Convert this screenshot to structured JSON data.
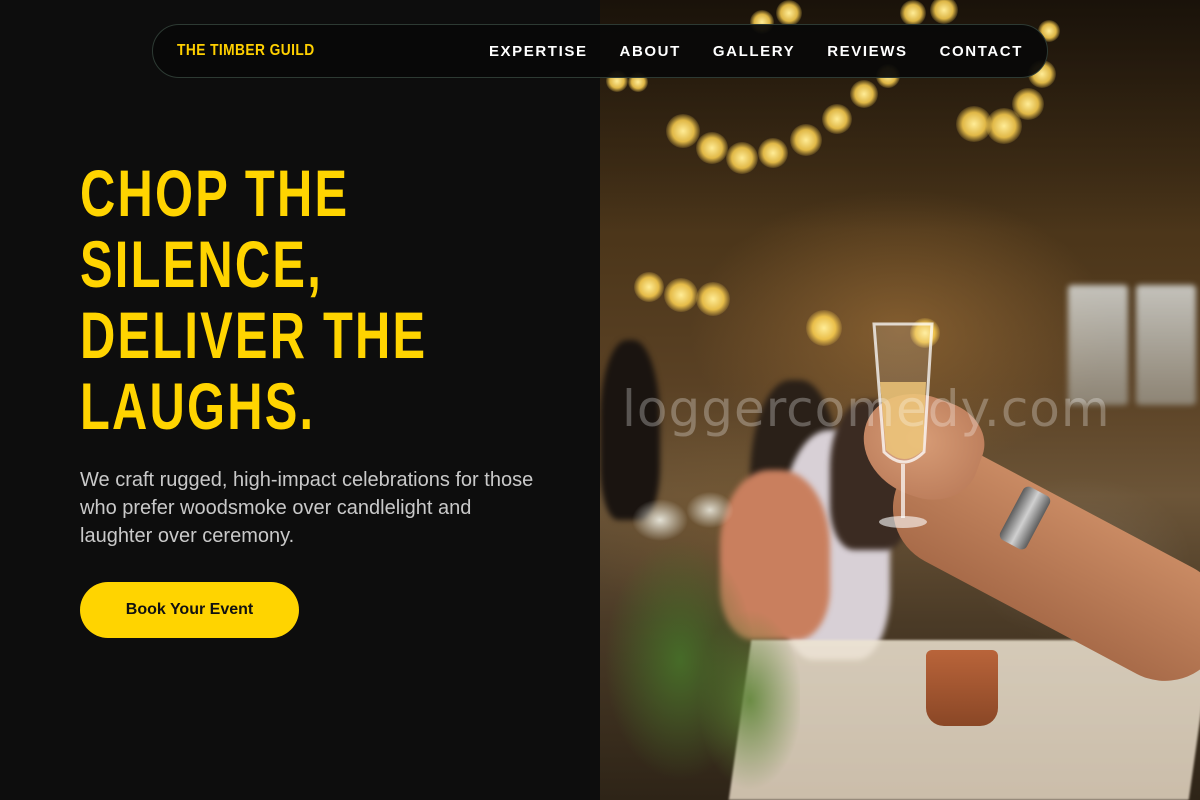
{
  "nav": {
    "brand": "THE TIMBER GUILD",
    "items": [
      "EXPERTISE",
      "ABOUT",
      "GALLERY",
      "REVIEWS",
      "CONTACT"
    ]
  },
  "hero": {
    "headline_lines": [
      "CHOP THE",
      "SILENCE,",
      "DELIVER THE",
      "LAUGHS."
    ],
    "subtext": "We craft rugged, high-impact celebrations for those who prefer woodsmoke over candlelight and laughter over ceremony.",
    "cta_label": "Book Your Event"
  },
  "photo": {
    "watermark": "loggercomedy.com"
  },
  "colors": {
    "accent": "#ffd400",
    "background": "#0d0d0d",
    "body_text": "#c9c9c9",
    "nav_text": "#ffffff"
  }
}
